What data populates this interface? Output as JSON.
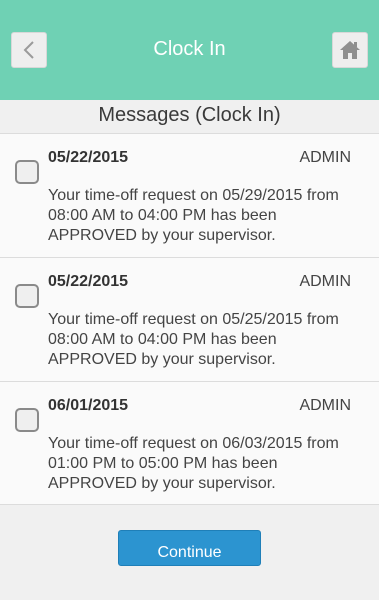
{
  "header": {
    "title": "Clock In",
    "back_icon": "chevron-left-icon",
    "home_icon": "home-icon",
    "color": "#6fd1b4"
  },
  "page": {
    "title": "Messages (Clock In)"
  },
  "messages": [
    {
      "date": "05/22/2015",
      "sender": "ADMIN",
      "body": "Your time-off request on 05/29/2015 from 08:00 AM to 04:00 PM has been APPROVED by your supervisor.",
      "checked": false
    },
    {
      "date": "05/22/2015",
      "sender": "ADMIN",
      "body": "Your time-off request on 05/25/2015 from 08:00 AM to 04:00 PM has been APPROVED by your supervisor.",
      "checked": false
    },
    {
      "date": "06/01/2015",
      "sender": "ADMIN",
      "body": "Your time-off request on 06/03/2015 from 01:00 PM to 05:00 PM has been APPROVED by your supervisor.",
      "checked": false
    }
  ],
  "actions": {
    "continue_label": "Continue",
    "continue_color": "#2c94d0"
  }
}
